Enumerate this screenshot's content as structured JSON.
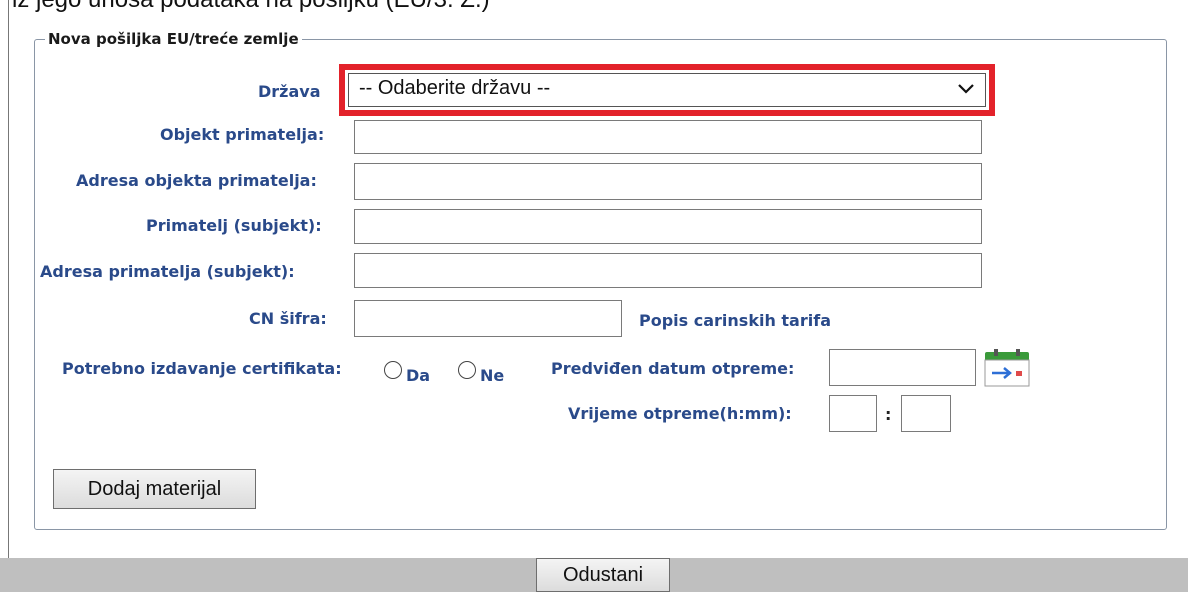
{
  "top": {
    "partial_text": "iz jego unosa podataka na pošiljku (EU/3. Z.)"
  },
  "form": {
    "legend": "Nova pošiljka EU/treće zemlje",
    "drzava": {
      "label": "Država",
      "selected": "-- Odaberite državu --"
    },
    "objekt_primatelja": {
      "label": "Objekt primatelja:",
      "value": ""
    },
    "adresa_objekta": {
      "label": "Adresa objekta primatelja:",
      "value": ""
    },
    "primatelj": {
      "label": "Primatelj (subjekt):",
      "value": ""
    },
    "adresa_primatelja": {
      "label": "Adresa primatelja (subjekt):",
      "value": ""
    },
    "cn_sifra": {
      "label": "CN šifra:",
      "value": ""
    },
    "popis_link": "Popis carinskih tarifa",
    "certifikati": {
      "label": "Potrebno izdavanje certifikata:",
      "option_yes": "Da",
      "option_no": "Ne"
    },
    "datum_otpreme": {
      "label": "Predviđen datum otpreme:",
      "value": ""
    },
    "vrijeme_otpreme": {
      "label": "Vrijeme otpreme(h:mm):",
      "separator": ":",
      "hours": "",
      "minutes": ""
    },
    "add_material_button": "Dodaj materijal"
  },
  "footer": {
    "cancel_button": "Odustani"
  },
  "colors": {
    "label_blue": "#2a4a8a",
    "highlight_red": "#e3222a",
    "footer_gray": "#bfbfbf",
    "calendar_green": "#3a9a3a"
  },
  "icons": {
    "calendar": "calendar-icon",
    "dropdown": "chevron-down-icon"
  }
}
